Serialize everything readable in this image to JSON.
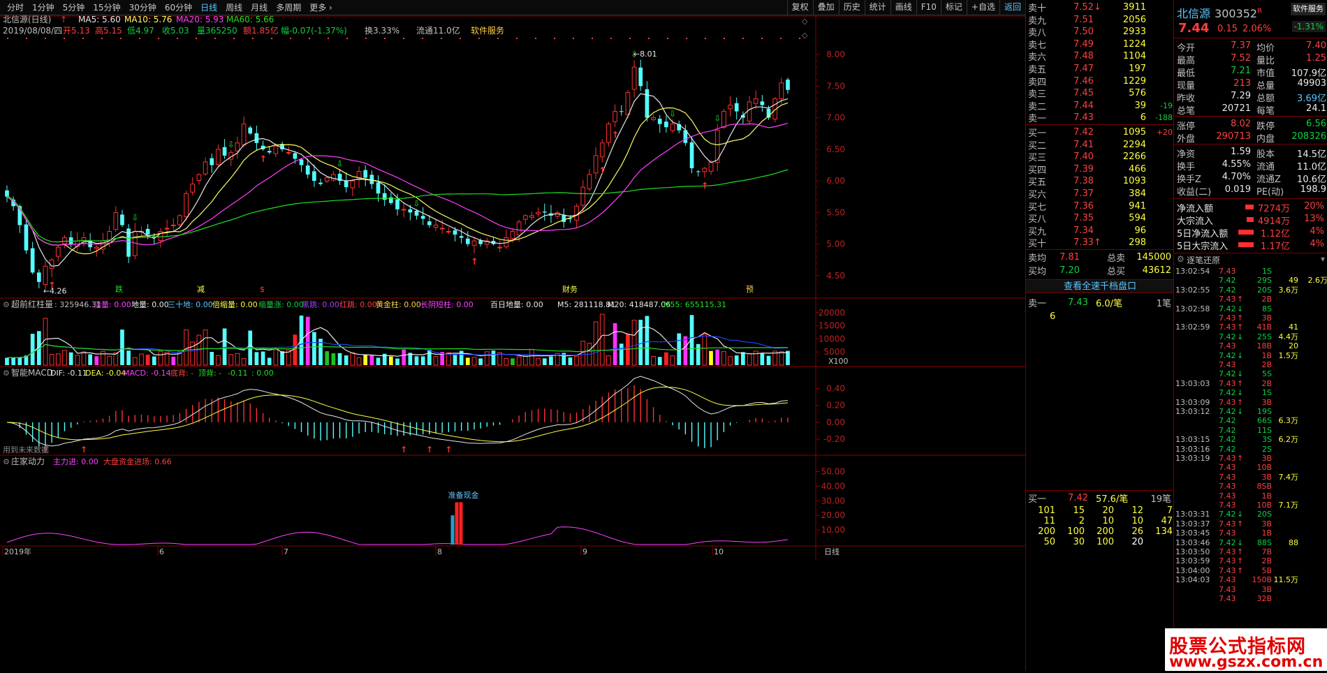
{
  "toolbar": {
    "tabs": [
      "分时",
      "1分钟",
      "5分钟",
      "15分钟",
      "30分钟",
      "60分钟",
      "日线",
      "周线",
      "月线",
      "多周期",
      "更多 ›"
    ],
    "active_tab": "日线",
    "right_buttons": [
      "复权",
      "叠加",
      "历史",
      "统计",
      "画线",
      "F10",
      "标记",
      "+自选",
      "返回"
    ]
  },
  "header": {
    "line1": {
      "name": "北信源(日线)",
      "ma5": "MA5: 5.60",
      "ma10": "MA10: 5.76",
      "ma20": "MA20: 5.93",
      "ma60": "MA60: 5.66"
    },
    "line2": {
      "date": "2019/08/08/四",
      "open": "开5.13",
      "high": "高5.15",
      "low": "低4.97",
      "close": "收5.03",
      "vol": "量365250",
      "amt": "额1.85亿",
      "chg": "幅-0.07(-1.37%)",
      "turn": "换3.33%",
      "float": "流通11.0亿",
      "sector": "软件服务"
    }
  },
  "price_axis": [
    "8.00",
    "7.50",
    "7.00",
    "6.50",
    "6.00",
    "5.50",
    "5.00",
    "4.50"
  ],
  "annotations": {
    "high": "8.01",
    "low": "4.26",
    "tags": [
      "跌",
      "减",
      "$",
      "财务",
      "预"
    ]
  },
  "vol_panel": {
    "title": "超前红柱量",
    "items": [
      {
        "label": ": 325946.31",
        "color": "#c0c0c0"
      },
      {
        "label": "倍量: 0.00",
        "color": "#ff40ff"
      },
      {
        "label": "地量: 0.00",
        "color": "#e8e8e8"
      },
      {
        "label": "三十地: 0.00",
        "color": "#5cc7ff"
      },
      {
        "label": "倍缩量: 0.00",
        "color": "#ffff40"
      },
      {
        "label": "缩量涨: 0.00",
        "color": "#10d040"
      },
      {
        "label": "黑跳: 0.00",
        "color": "#a040ff"
      },
      {
        "label": "红跳: 0.00",
        "color": "#ff4040"
      },
      {
        "label": "黄金柱: 0.00",
        "color": "#ffd040"
      },
      {
        "label": "长阴短柱: 0.00",
        "color": "#ff40ff"
      }
    ],
    "bairi": "百日地量: 0.00",
    "m5": "M5: 281118.81",
    "m20": "M20: 418487.06",
    "m55": "M55: 655115.31",
    "axis": [
      "20000",
      "15000",
      "10000",
      "5000"
    ],
    "unit": "X100"
  },
  "macd_panel": {
    "title": "智能MACD",
    "dif": "DIF: -0.11",
    "dea": "DEA: -0.04",
    "macd": "MACD: -0.14",
    "dibei": "底背: -",
    "dingbei": "顶背: -",
    "v1": "-0.11",
    "v2": ": 0.00",
    "axis": [
      "0.40",
      "0.20",
      "0.00",
      "-0.20"
    ],
    "note": "用到未来数据"
  },
  "zj_panel": {
    "title": "庄家动力",
    "a": "主力进: 0.00",
    "b": "大盘资金进场: 0.66",
    "axis": [
      "50.00",
      "40.00",
      "30.00",
      "20.00",
      "10.00"
    ],
    "label": "准备现金"
  },
  "x_axis": {
    "labels": [
      "2019年",
      "6",
      "7",
      "8",
      "9",
      "10"
    ],
    "period": "日线"
  },
  "orderbook": {
    "asks": [
      {
        "lbl": "卖十",
        "p": "7.52",
        "m": "↓",
        "v": "3911",
        "c": ""
      },
      {
        "lbl": "卖九",
        "p": "7.51",
        "v": "2056",
        "c": ""
      },
      {
        "lbl": "卖八",
        "p": "7.50",
        "v": "2933",
        "c": ""
      },
      {
        "lbl": "卖七",
        "p": "7.49",
        "v": "1224",
        "c": ""
      },
      {
        "lbl": "卖六",
        "p": "7.48",
        "v": "1104",
        "c": ""
      },
      {
        "lbl": "卖五",
        "p": "7.47",
        "v": "197",
        "c": ""
      },
      {
        "lbl": "卖四",
        "p": "7.46",
        "v": "1229",
        "c": ""
      },
      {
        "lbl": "卖三",
        "p": "7.45",
        "v": "576",
        "c": ""
      },
      {
        "lbl": "卖二",
        "p": "7.44",
        "v": "39",
        "c": "-19"
      },
      {
        "lbl": "卖一",
        "p": "7.43",
        "v": "6",
        "c": "-188"
      }
    ],
    "bids": [
      {
        "lbl": "买一",
        "p": "7.42",
        "v": "1095",
        "c": "+20"
      },
      {
        "lbl": "买二",
        "p": "7.41",
        "v": "2294",
        "c": ""
      },
      {
        "lbl": "买三",
        "p": "7.40",
        "v": "2266",
        "c": ""
      },
      {
        "lbl": "买四",
        "p": "7.39",
        "v": "466",
        "c": ""
      },
      {
        "lbl": "买五",
        "p": "7.38",
        "v": "1093",
        "c": ""
      },
      {
        "lbl": "买六",
        "p": "7.37",
        "v": "384",
        "c": ""
      },
      {
        "lbl": "买七",
        "p": "7.36",
        "v": "941",
        "c": ""
      },
      {
        "lbl": "买八",
        "p": "7.35",
        "v": "594",
        "c": ""
      },
      {
        "lbl": "买九",
        "p": "7.34",
        "v": "96",
        "c": ""
      },
      {
        "lbl": "买十",
        "p": "7.33",
        "m": "↑",
        "v": "298",
        "c": ""
      }
    ],
    "avg_sell": {
      "lbl": "卖均",
      "p": "7.81",
      "t": "总卖",
      "v": "145000"
    },
    "avg_buy": {
      "lbl": "买均",
      "p": "7.20",
      "t": "总买",
      "v": "43612"
    },
    "link": "查看全速千档盘口",
    "s1": {
      "lbl": "卖一",
      "p": "7.43",
      "per": "6.0/笔",
      "n": "1笔",
      "q": "6"
    },
    "b1": {
      "lbl": "买一",
      "p": "7.42",
      "per": "57.6/笔",
      "n": "19笔"
    },
    "queue": [
      [
        "101",
        "15",
        "20",
        "12",
        "7"
      ],
      [
        "11",
        "2",
        "10",
        "10",
        "47"
      ],
      [
        "200",
        "100",
        "200",
        "26",
        "134"
      ],
      [
        "50",
        "30",
        "100",
        "20",
        ""
      ]
    ]
  },
  "quote": {
    "name": "北信源",
    "code": "300352",
    "r": "R",
    "industry": "软件服务",
    "ind_chg": "-1.31%",
    "last": "7.44",
    "chg": "0.15",
    "pct": "2.06%",
    "rows": [
      [
        [
          "今开",
          "7.37",
          "red"
        ],
        [
          "均价",
          "7.40",
          "red"
        ]
      ],
      [
        [
          "最高",
          "7.52",
          "red"
        ],
        [
          "量比",
          "1.25",
          "red"
        ]
      ],
      [
        [
          "最低",
          "7.21",
          "grn"
        ],
        [
          "市值",
          "107.9亿",
          "wht"
        ]
      ],
      [
        [
          "现量",
          "213",
          "red"
        ],
        [
          "总量",
          "49903",
          "wht"
        ]
      ],
      [
        [
          "昨收",
          "7.29",
          "wht"
        ],
        [
          "总额",
          "3.69亿",
          "cyn"
        ]
      ],
      [
        [
          "总笔",
          "20721",
          "wht"
        ],
        [
          "每笔",
          "24.1",
          "wht"
        ]
      ],
      [
        [
          "涨停",
          "8.02",
          "red"
        ],
        [
          "跌停",
          "6.56",
          "grn"
        ]
      ],
      [
        [
          "外盘",
          "290713",
          "red"
        ],
        [
          "内盘",
          "208326",
          "grn"
        ]
      ],
      [
        [
          "净资",
          "1.59",
          "wht"
        ],
        [
          "股本",
          "14.5亿",
          "wht"
        ]
      ],
      [
        [
          "换手",
          "4.55%",
          "wht"
        ],
        [
          "流通",
          "11.0亿",
          "wht"
        ]
      ],
      [
        [
          "换手Z",
          "4.70%",
          "wht"
        ],
        [
          "流通Z",
          "10.6亿",
          "wht"
        ]
      ],
      [
        [
          "收益(二)",
          "0.019",
          "wht"
        ],
        [
          "PE(动)",
          "198.9",
          "wht"
        ]
      ]
    ],
    "flows": [
      {
        "lbl": "净流入额",
        "v": "7274万",
        "p": "20%",
        "w": 12
      },
      {
        "lbl": "大宗流入",
        "v": "4914万",
        "p": "13%",
        "w": 10
      },
      {
        "lbl": "5日净流入额",
        "v": "1.12亿",
        "p": "4%",
        "w": 22
      },
      {
        "lbl": "5日大宗流入",
        "v": "1.17亿",
        "p": "4%",
        "w": 22
      }
    ]
  },
  "ticks": {
    "title": "逐笔还原",
    "rows": [
      [
        "13:02:54",
        "7.43",
        "",
        "1S",
        "",
        ""
      ],
      [
        "",
        "7.42",
        "",
        "29S",
        "49",
        "2.6万"
      ],
      [
        "13:02:55",
        "7.42",
        "",
        "20S",
        "3.6万",
        ""
      ],
      [
        "",
        "7.43",
        "↑",
        "2B",
        "",
        ""
      ],
      [
        "13:02:58",
        "7.42",
        "↓",
        "8S",
        "",
        ""
      ],
      [
        "",
        "7.43",
        "↑",
        "3B",
        "",
        ""
      ],
      [
        "13:02:59",
        "7.43",
        "↑",
        "41B",
        "41",
        "",
        ""
      ],
      [
        "",
        "7.42",
        "↓",
        "25S",
        "4.4万",
        ""
      ],
      [
        "",
        "7.43",
        "",
        "18B",
        "20",
        ""
      ],
      [
        "",
        "7.42",
        "↓",
        "1B",
        "1.5万",
        ""
      ],
      [
        "",
        "7.43",
        "",
        "2B",
        "",
        ""
      ],
      [
        "",
        "7.42",
        "↓",
        "5S",
        "",
        ""
      ],
      [
        "13:03:03",
        "7.43",
        "↑",
        "2B",
        "",
        ""
      ],
      [
        "",
        "7.42",
        "↓",
        "1S",
        "",
        ""
      ],
      [
        "13:03:09",
        "7.43",
        "↑",
        "3B",
        "",
        ""
      ],
      [
        "13:03:12",
        "7.42",
        "↓",
        "19S",
        "",
        ""
      ],
      [
        "",
        "7.42",
        "",
        "66S",
        "6.3万",
        ""
      ],
      [
        "",
        "7.42",
        "",
        "11S",
        "",
        ""
      ],
      [
        "13:03:15",
        "7.42",
        "",
        "3S",
        "6.2万",
        ""
      ],
      [
        "13:03:16",
        "7.42",
        "",
        "2S",
        "",
        ""
      ],
      [
        "13:03:19",
        "7.43",
        "↑",
        "3B",
        "",
        ""
      ],
      [
        "",
        "7.43",
        "",
        "10B",
        "",
        ""
      ],
      [
        "",
        "7.43",
        "",
        "3B",
        "7.4万",
        ""
      ],
      [
        "",
        "7.43",
        "",
        "8SB",
        "",
        ""
      ],
      [
        "",
        "7.43",
        "",
        "1B",
        "",
        ""
      ],
      [
        "",
        "7.43",
        "",
        "10B",
        "7.1万",
        ""
      ],
      [
        "13:03:31",
        "7.42",
        "↓",
        "20S",
        "",
        ""
      ],
      [
        "13:03:37",
        "7.43",
        "↑",
        "3B",
        "",
        ""
      ],
      [
        "13:03:45",
        "7.43",
        "",
        "1B",
        "",
        ""
      ],
      [
        "13:03:46",
        "7.42",
        "↓",
        "88S",
        "88",
        ""
      ],
      [
        "13:03:50",
        "7.43",
        "↑",
        "7B",
        "",
        ""
      ],
      [
        "13:03:59",
        "7.43",
        "↑",
        "2B",
        "",
        ""
      ],
      [
        "13:04:00",
        "7.43",
        "↑",
        "5B",
        "",
        ""
      ],
      [
        "13:04:03",
        "7.43",
        "",
        "150B",
        "11.5万",
        ""
      ],
      [
        "",
        "7.43",
        "",
        "3B",
        "",
        ""
      ],
      [
        "",
        "7.43",
        "",
        "32B",
        "",
        ""
      ]
    ]
  },
  "watermark": {
    "line1": "股票公式指标网",
    "line2": "www.gszx.com.cn"
  },
  "chart_data": {
    "type": "candlestick",
    "ylim": [
      4.2,
      8.2
    ],
    "ma5_label": "MA5",
    "ma10_label": "MA10",
    "ma20_label": "MA20",
    "ma60_label": "MA60",
    "colors": {
      "up": "#ff3030",
      "down": "#54ffff",
      "ma5": "#e8e8e8",
      "ma10": "#ffff60",
      "ma20": "#ff40ff",
      "ma60": "#20e020"
    }
  }
}
